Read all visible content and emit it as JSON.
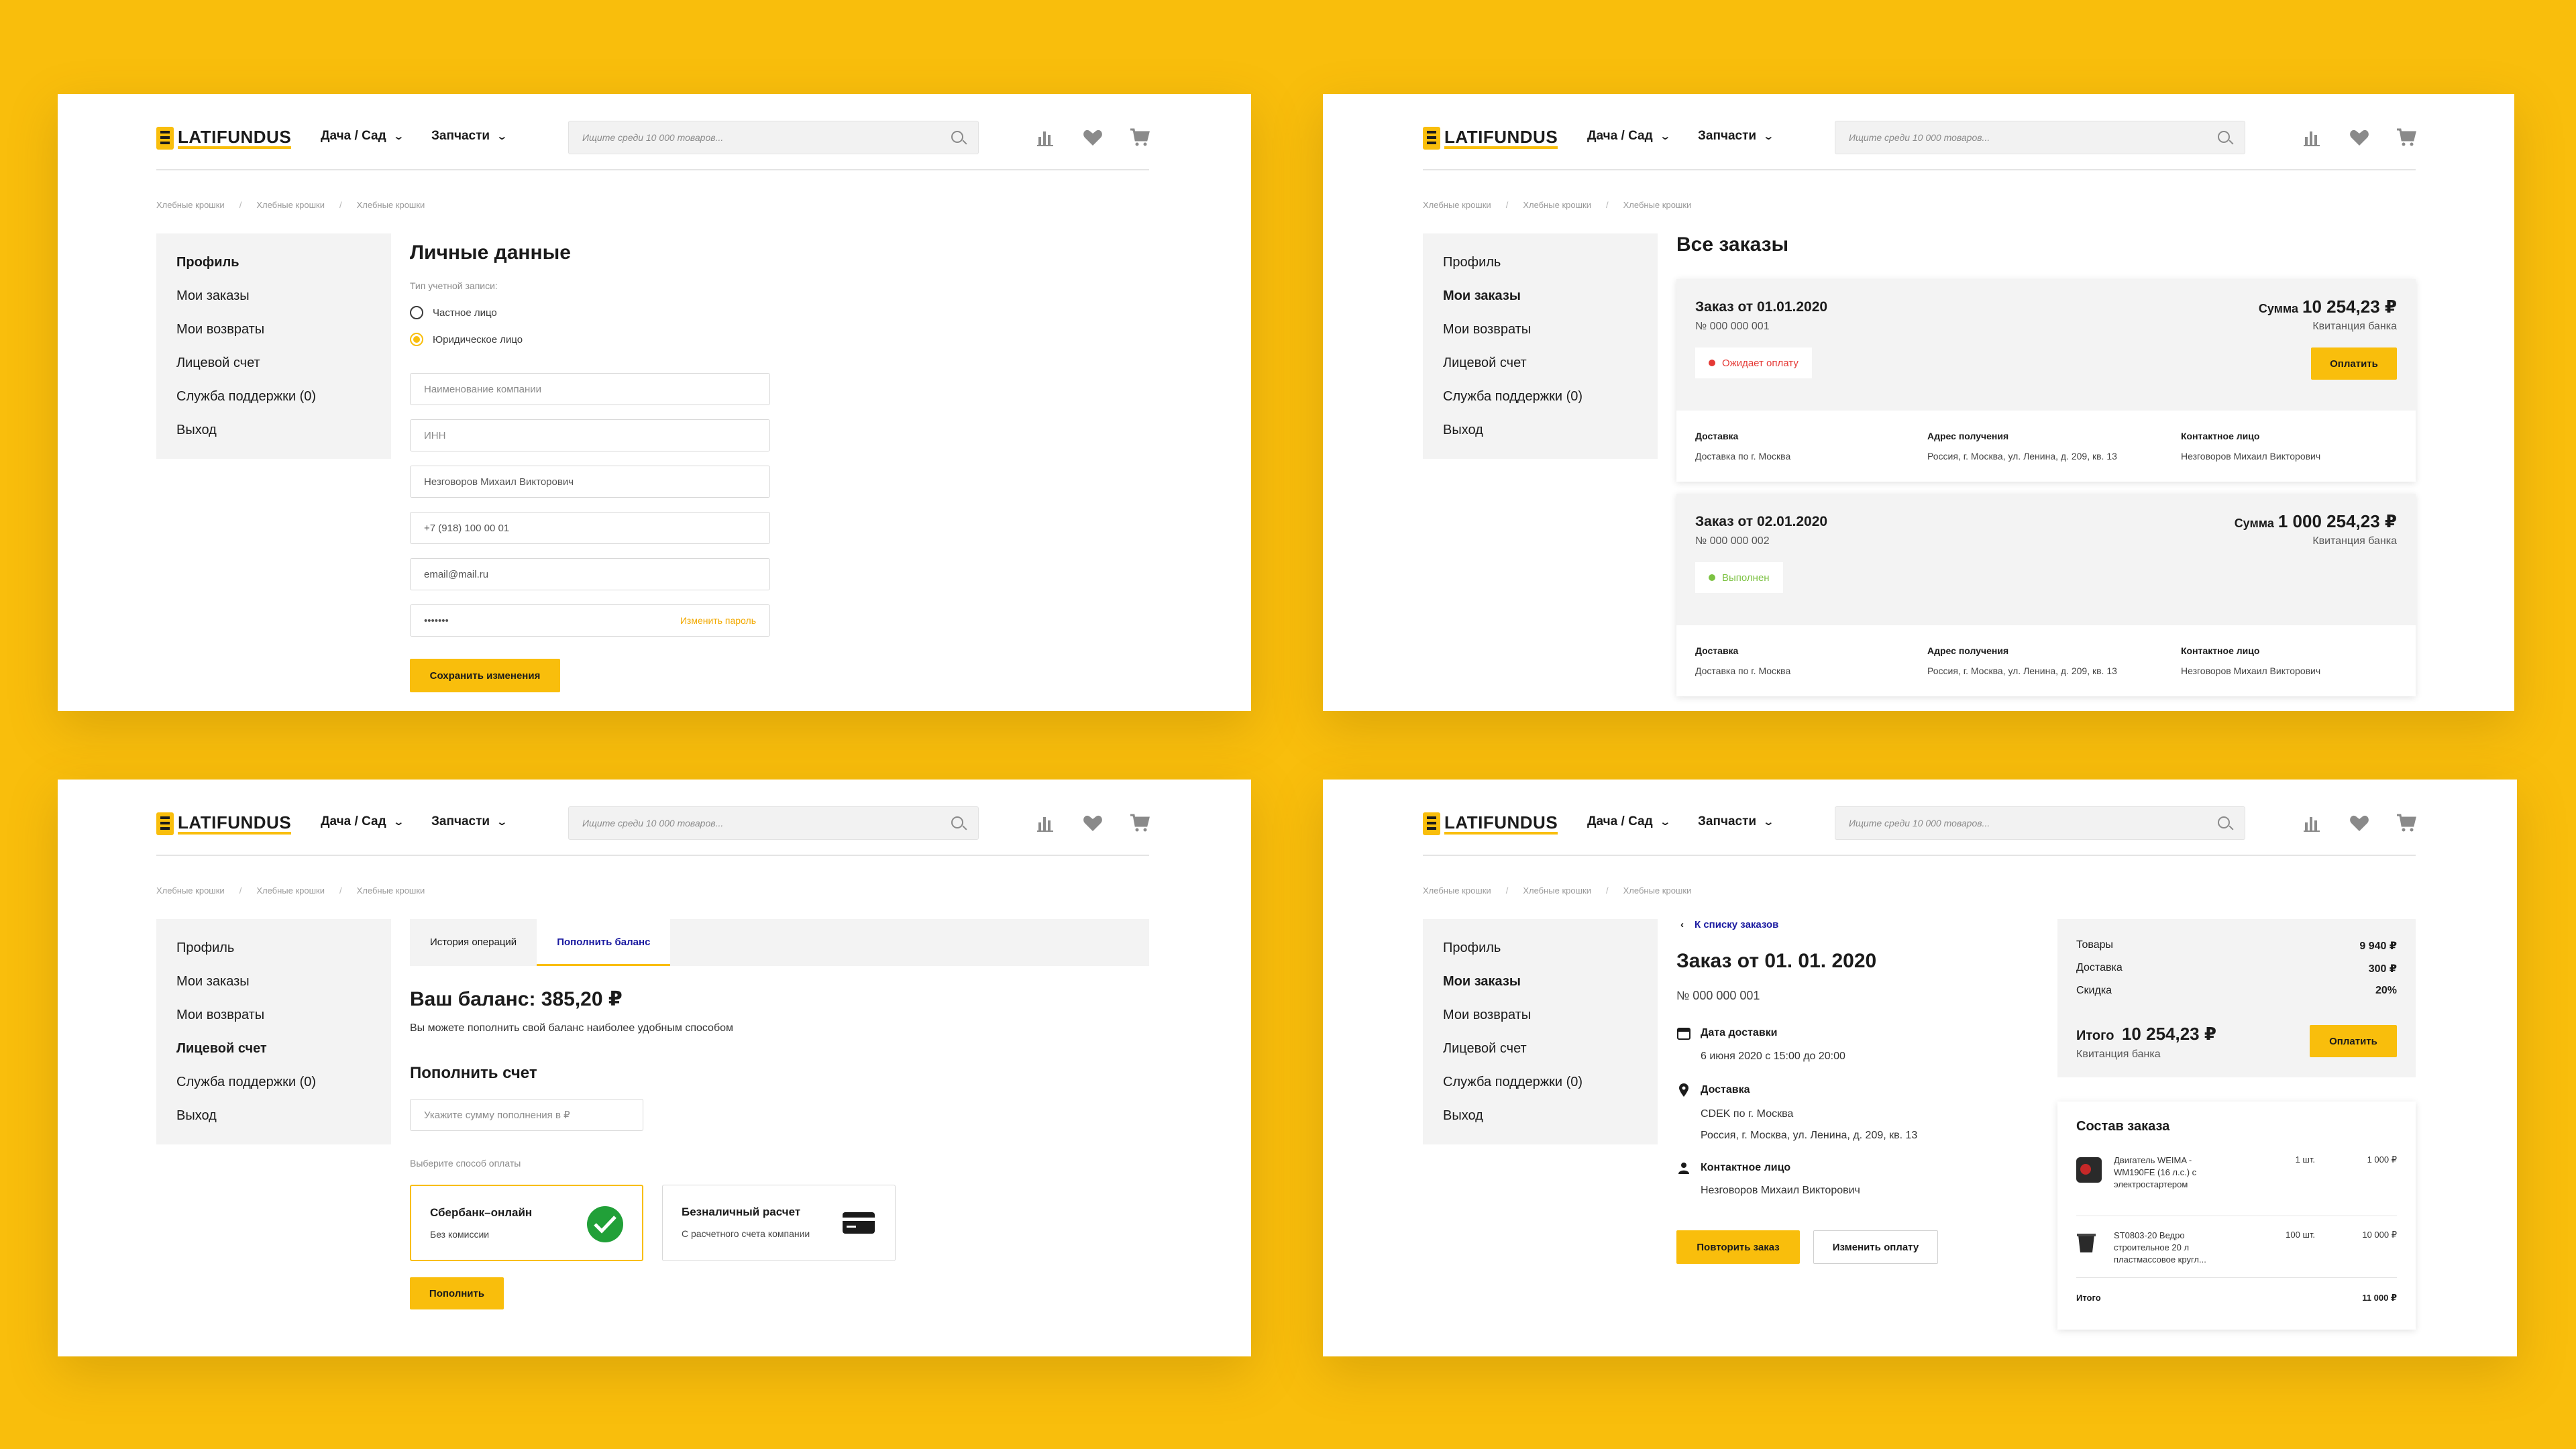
{
  "header": {
    "logo": "LATIFUNDUS",
    "nav": [
      "Дача / Сад",
      "Запчасти"
    ],
    "search_placeholder": "Ищите среди 10 000 товаров...",
    "icons": [
      "compare-icon",
      "heart-icon",
      "cart-icon"
    ]
  },
  "breadcrumbs": [
    "Хлебные крошки",
    "Хлебные крошки",
    "Хлебные крошки"
  ],
  "sidebar": [
    "Профиль",
    "Мои заказы",
    "Мои возвраты",
    "Лицевой счет",
    "Служба поддержки (0)",
    "Выход"
  ],
  "profile": {
    "title": "Личные данные",
    "account_type_label": "Тип учетной записи:",
    "radio_private": "Частное лицо",
    "radio_legal": "Юридическое лицо",
    "company_placeholder": "Наименование компании",
    "inn_placeholder": "ИНН",
    "name_value": "Незговоров Михаил Викторович",
    "phone_value": "+7 (918) 100 00 01",
    "email_value": "email@mail.ru",
    "password_value": "•••••••",
    "change_password": "Изменить пароль",
    "save_button": "Сохранить изменения"
  },
  "orders": {
    "title": "Все заказы",
    "sum_label": "Сумма",
    "receipt": "Квитанция банка",
    "pay_button": "Оплатить",
    "delivery_h": "Доставка",
    "address_h": "Адрес получения",
    "contact_h": "Контактное лицо",
    "items": [
      {
        "title": "Заказ от 01.01.2020",
        "number": "№ 000 000 001",
        "sum": "10 254,23 ₽",
        "status": "Ожидает оплату",
        "status_color": "#E53935",
        "delivery": "Доставка по г. Москва",
        "address": "Россия, г. Москва, ул. Ленина, д. 209, кв. 13",
        "contact": "Незговоров Михаил Викторович"
      },
      {
        "title": "Заказ от 02.01.2020",
        "number": "№ 000 000 002",
        "sum": "1 000 254,23 ₽",
        "status": "Выполнен",
        "status_color": "#7CC242",
        "delivery": "Доставка по г. Москва",
        "address": "Россия, г. Москва, ул. Ленина, д. 209, кв. 13",
        "contact": "Незговоров Михаил Викторович"
      }
    ]
  },
  "balance": {
    "tab_history": "История операций",
    "tab_topup": "Пополнить баланс",
    "title": "Ваш баланс: 385,20 ₽",
    "subtitle": "Вы можете пополнить свой баланс наиболее удобным способом",
    "topup_title": "Пополнить счет",
    "amount_placeholder": "Укажите сумму пополнения в ₽",
    "method_label": "Выберите способ оплаты",
    "method1_title": "Сбербанк–онлайн",
    "method1_sub": "Без комиссии",
    "method2_title": "Безналичный расчет",
    "method2_sub": "С расчетного счета компании",
    "topup_button": "Пополнить"
  },
  "order_detail": {
    "back": "К списку заказов",
    "title": "Заказ от 01. 01. 2020",
    "number": "№ 000 000 001",
    "date_h": "Дата доставки",
    "date_v": "6 июня 2020 с 15:00 до 20:00",
    "delivery_h": "Доставка",
    "delivery_v1": "CDEK по г. Москва",
    "delivery_v2": "Россия, г. Москва, ул. Ленина, д. 209, кв. 13",
    "contact_h": "Контактное лицо",
    "contact_v": "Незговоров Михаил Викторович",
    "repeat_button": "Повторить заказ",
    "change_pay_button": "Изменить оплату",
    "summary": {
      "goods_label": "Товары",
      "goods_value": "9 940 ₽",
      "delivery_label": "Доставка",
      "delivery_value": "300 ₽",
      "discount_label": "Скидка",
      "discount_value": "20%",
      "total_label": "Итого",
      "total_value": "10 254,23 ₽",
      "receipt": "Квитанция банка",
      "pay_button": "Оплатить"
    },
    "composition": {
      "title": "Состав заказа",
      "items": [
        {
          "name": "Двигатель WEIMA - WM190FE (16 л.с.) с электростартером",
          "qty": "1 шт.",
          "price": "1 000 ₽"
        },
        {
          "name": "ST0803-20 Ведро строительное 20 л пластмассовое кругл...",
          "qty": "100 шт.",
          "price": "10 000 ₽"
        }
      ],
      "total_label": "Итого",
      "total_value": "11 000 ₽"
    }
  },
  "colors": {
    "accent": "#F9BE0C",
    "background": "#F9BE0C",
    "link_blue": "#1a1aa0"
  }
}
